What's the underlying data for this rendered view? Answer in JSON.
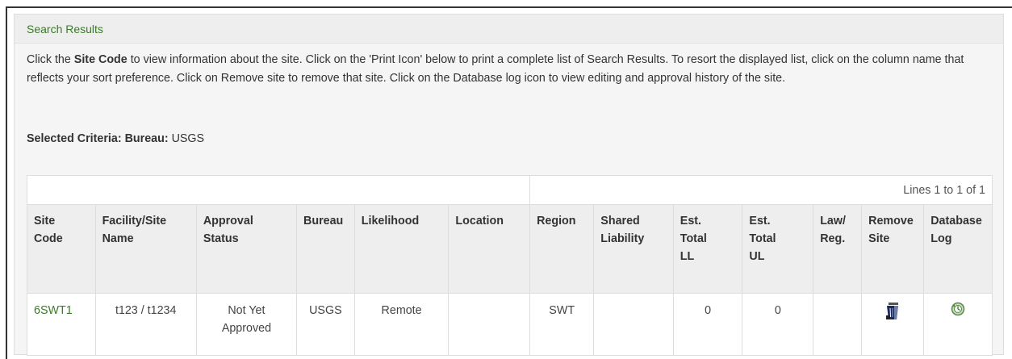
{
  "panel": {
    "title": "Search Results",
    "intro": {
      "part1": "Click the ",
      "bold": "Site Code",
      "part2": " to view information about the site. Click on the 'Print Icon' below to print a complete list of Search Results. To resort the displayed list, click on the column name that reflects your sort preference. Click on Remove site to remove that site. Click on the Database log icon to view editing and approval history of the site."
    },
    "criteria": {
      "label": "Selected Criteria: Bureau:",
      "value": " USGS"
    }
  },
  "table": {
    "lines_text": "Lines 1 to 1 of 1",
    "headers": [
      [
        "Site",
        "Code"
      ],
      [
        "Facility/Site",
        "Name"
      ],
      [
        "Approval",
        "Status"
      ],
      [
        "Bureau"
      ],
      [
        "Likelihood"
      ],
      [
        "Location"
      ],
      [
        "Region"
      ],
      [
        "Shared",
        "Liability"
      ],
      [
        "Est.",
        "Total",
        "LL"
      ],
      [
        "Est.",
        "Total",
        "UL"
      ],
      [
        "Law/",
        "Reg."
      ],
      [
        "Remove",
        "Site"
      ],
      [
        "Database",
        "Log"
      ]
    ],
    "rows": [
      {
        "site_code": "6SWT1",
        "facility_name": "t123 / t1234",
        "approval_status": [
          "Not Yet",
          "Approved"
        ],
        "bureau": "USGS",
        "likelihood": "Remote",
        "location": "",
        "region": "SWT",
        "shared_liability": "",
        "est_total_ll": "0",
        "est_total_ul": "0",
        "law_reg": "",
        "remove_icon": "trash-bin-icon",
        "log_icon": "database-log-icon"
      }
    ]
  },
  "colors": {
    "link_green": "#3a7a28",
    "panel_bg": "#f5f5f5",
    "header_bg": "#eeeeee",
    "border": "#dddddd"
  }
}
